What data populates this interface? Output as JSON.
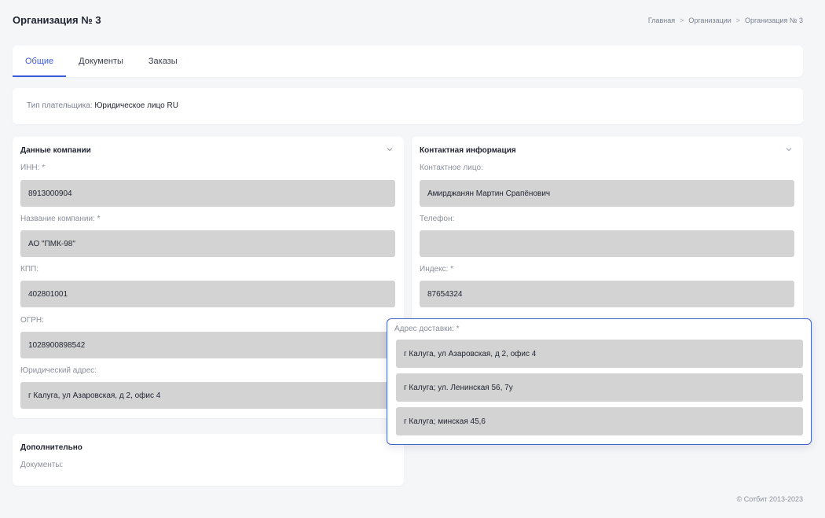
{
  "header": {
    "title": "Организация № 3",
    "breadcrumb": [
      "Главная",
      "Организации",
      "Организация № 3"
    ],
    "separator": ">"
  },
  "tabs": [
    {
      "label": "Общие",
      "active": true
    },
    {
      "label": "Документы",
      "active": false
    },
    {
      "label": "Заказы",
      "active": false
    }
  ],
  "payer": {
    "label": "Тип плательщика:",
    "value": "Юридическое лицо RU"
  },
  "company": {
    "title": "Данные компании",
    "fields": [
      {
        "label": "ИНН: *",
        "value": "8913000904"
      },
      {
        "label": "Название компании: *",
        "value": "АО \"ПМК-98\""
      },
      {
        "label": "КПП:",
        "value": "402801001"
      },
      {
        "label": "ОГРН:",
        "value": "1028900898542"
      },
      {
        "label": "Юридический адрес:",
        "value": "г Калуга, ул Азаровская, д 2, офис 4"
      }
    ]
  },
  "contact": {
    "title": "Контактная информация",
    "fields": [
      {
        "label": "Контактное лицо:",
        "value": "Амирджанян Мартин Срапёнович"
      },
      {
        "label": "Телефон:",
        "value": ""
      },
      {
        "label": "Индекс: *",
        "value": "87654324"
      }
    ]
  },
  "delivery_dropdown": {
    "label": "Адрес доставки: *",
    "options": [
      "г Калуга, ул Азаровская, д 2, офис 4",
      "г Калуга; ул. Ленинская 56, 7у",
      "г Калуга; минская 45,6"
    ]
  },
  "extra": {
    "title": "Дополнительно",
    "documents_label": "Документы:"
  },
  "footer": {
    "copyright": "© Сотбит 2013-2023"
  },
  "colors": {
    "accent": "#3b5bdb",
    "field_bg": "#d3d3d3",
    "page_bg": "#f5f6f8",
    "dropdown_border": "#4263c9"
  }
}
